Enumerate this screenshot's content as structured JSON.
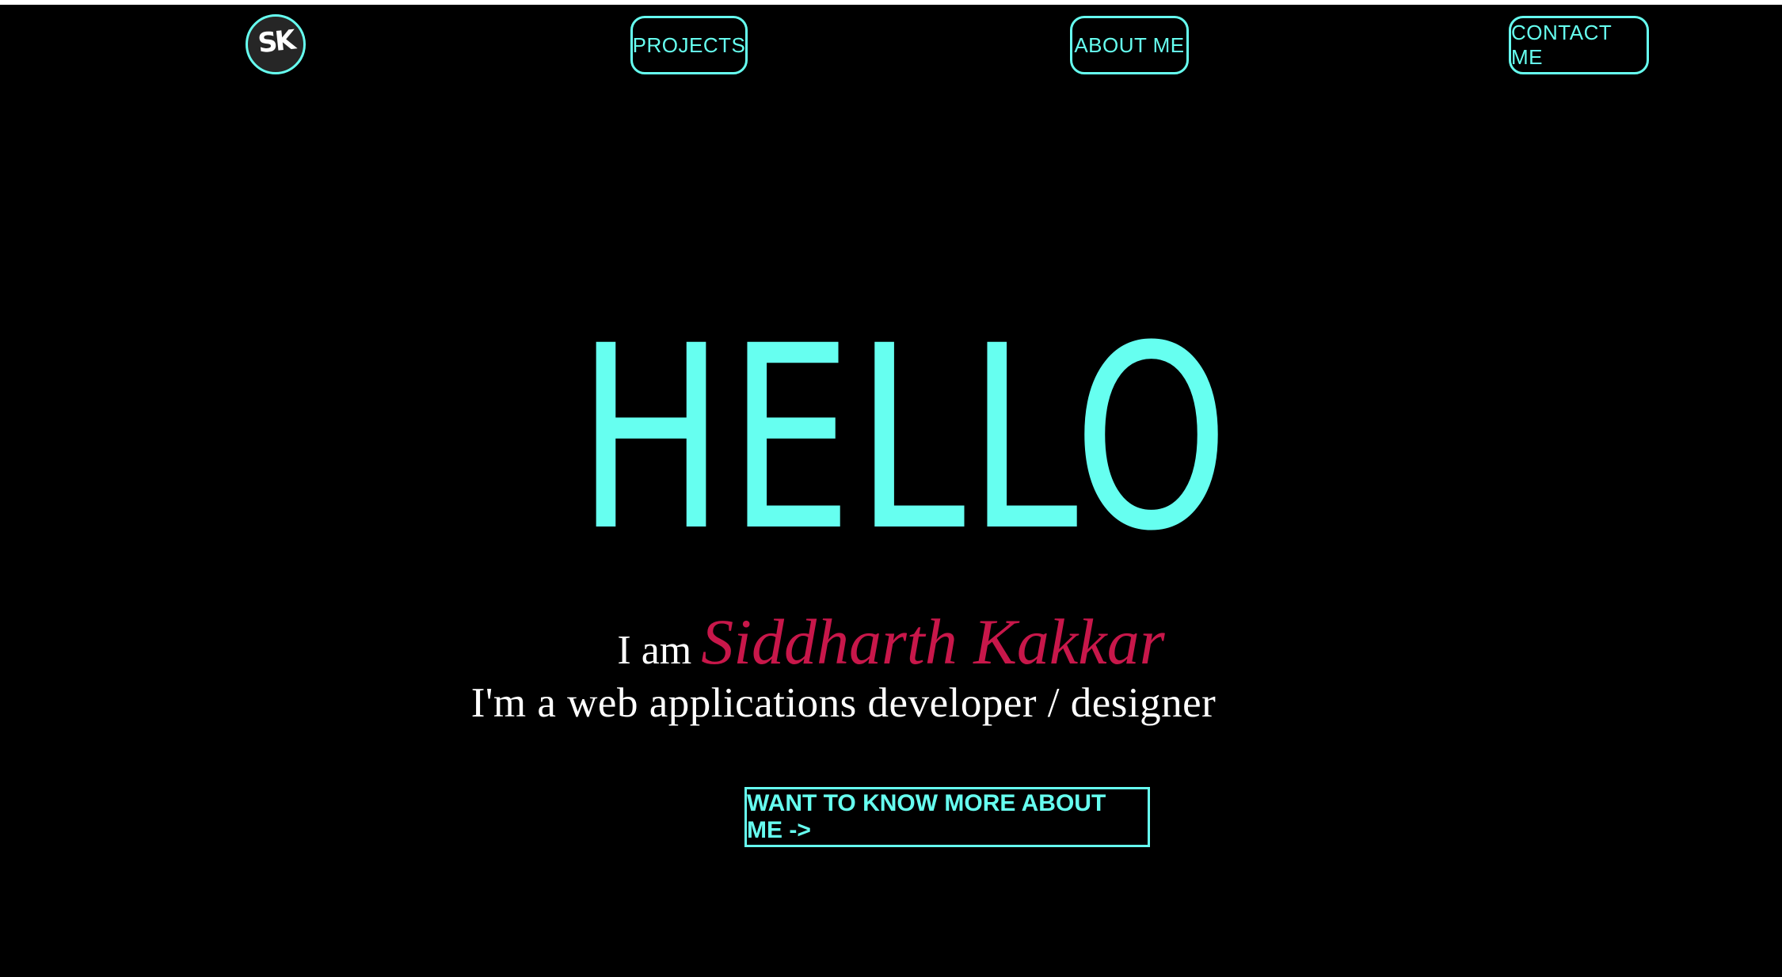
{
  "nav": {
    "logo_text": "SK",
    "projects_label": "PROJECTS",
    "about_label": "ABOUT ME",
    "contact_label": "CONTACT ME"
  },
  "hero": {
    "greeting": "HELLO",
    "intro_prefix": "I am",
    "name": "Siddharth Kakkar",
    "tagline": "I'm a web applications developer / designer",
    "cta_label": "WANT TO KNOW MORE ABOUT ME ->"
  },
  "colors": {
    "background": "#000000",
    "accent": "#66fff0",
    "name": "#c8174a",
    "text": "#ffffff"
  }
}
